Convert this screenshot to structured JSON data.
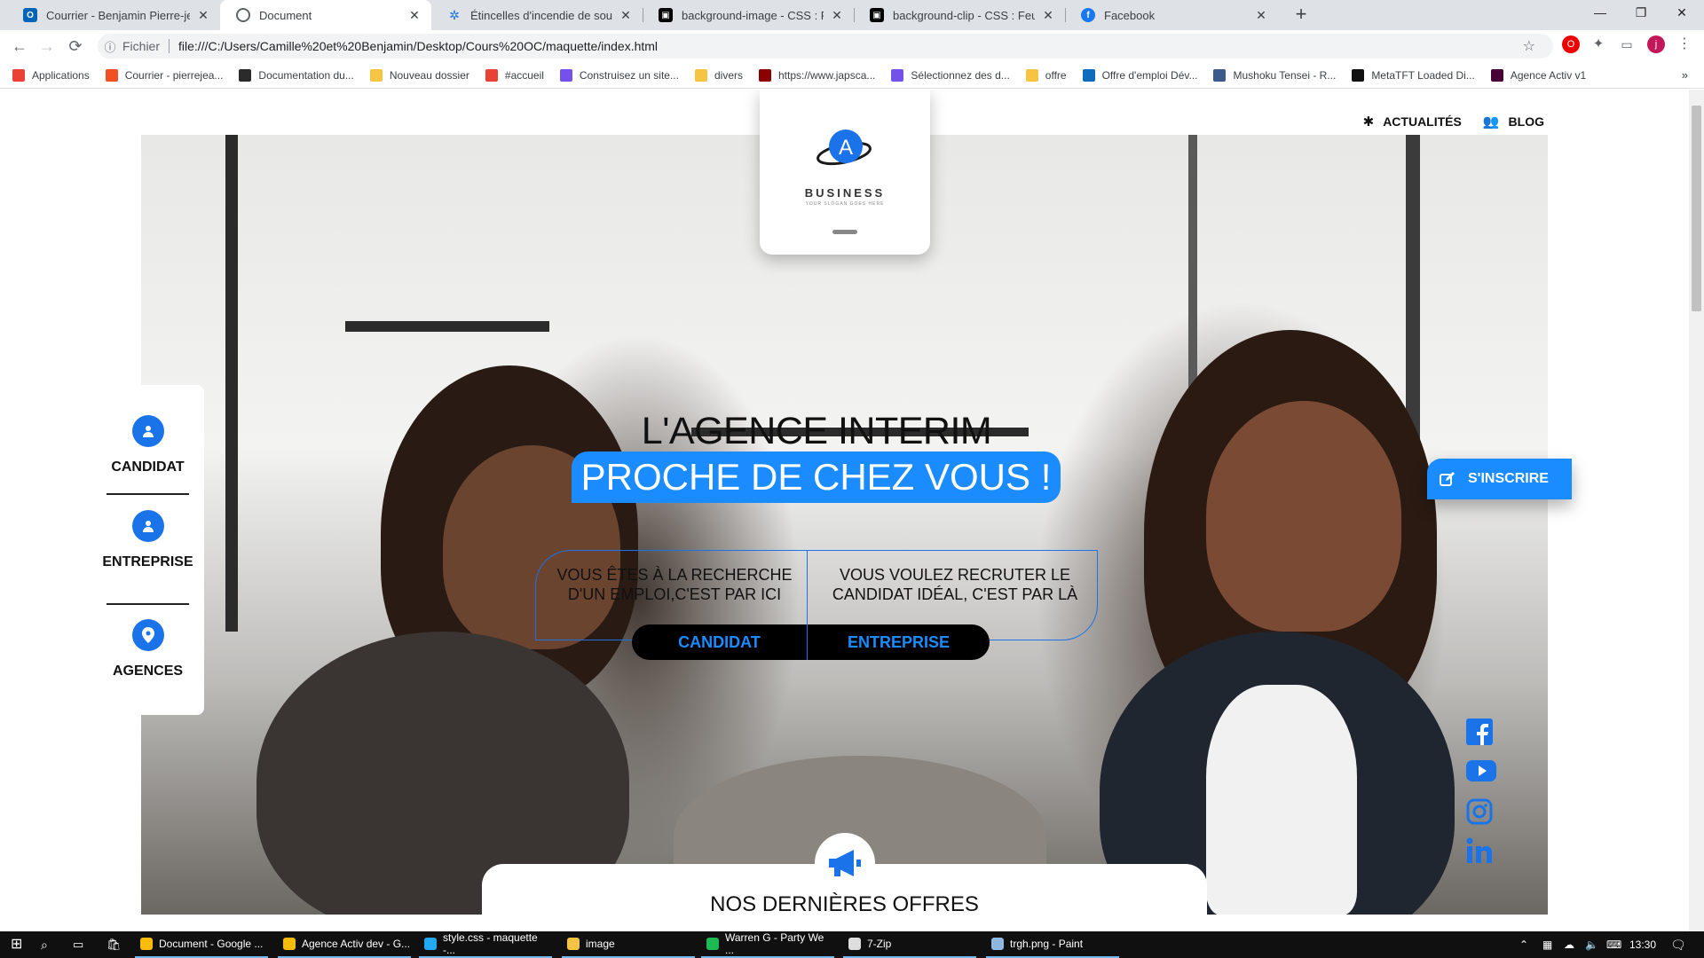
{
  "browser": {
    "tabs": [
      {
        "title": "Courrier - Benjamin Pierre-jean -",
        "favicon": "outlook-icon",
        "color": "#0364b8",
        "active": false
      },
      {
        "title": "Document",
        "favicon": "globe-icon",
        "color": "#5f6368",
        "active": true
      },
      {
        "title": "Étincelles d'incendie de soudage",
        "favicon": "settings-gear-icon",
        "color": "#1a73e8",
        "active": false
      },
      {
        "title": "background-image - CSS : Feuilles",
        "favicon": "mdn-icon",
        "color": "#000000",
        "active": false
      },
      {
        "title": "background-clip - CSS : Feuilles d",
        "favicon": "mdn-icon",
        "color": "#000000",
        "active": false
      },
      {
        "title": "Facebook",
        "favicon": "facebook-icon",
        "color": "#1877f2",
        "active": false
      }
    ],
    "new_tab_symbol": "+",
    "window_controls": {
      "minimize": "—",
      "maximize": "❐",
      "close": "✕"
    },
    "address": {
      "scheme_label": "Fichier",
      "url": "file:///C:/Users/Camille%20et%20Benjamin/Desktop/Cours%20OC/maquette/index.html"
    },
    "profile_initial": "j",
    "bookmarks": [
      {
        "label": "Applications",
        "icon": "apps-grid-icon",
        "color": "#ea4335"
      },
      {
        "label": "Courrier - pierrejea...",
        "icon": "microsoft-icon",
        "color": "#f25022"
      },
      {
        "label": "Documentation du...",
        "icon": "doc-icon",
        "color": "#2b2b2b"
      },
      {
        "label": "Nouveau dossier",
        "icon": "folder-icon",
        "color": "#f6c342"
      },
      {
        "label": "#accueil",
        "icon": "bookmark-icon",
        "color": "#e94235"
      },
      {
        "label": "Construisez un site...",
        "icon": "openclassrooms-icon",
        "color": "#7451eb"
      },
      {
        "label": "divers",
        "icon": "folder-icon",
        "color": "#f6c342"
      },
      {
        "label": "https://www.japsca...",
        "icon": "js-icon",
        "color": "#8b0000"
      },
      {
        "label": "Sélectionnez des d...",
        "icon": "openclassrooms-icon",
        "color": "#7451eb"
      },
      {
        "label": "offre",
        "icon": "folder-icon",
        "color": "#f6c342"
      },
      {
        "label": "Offre d'emploi Dév...",
        "icon": "edge-icon",
        "color": "#0f6cbd"
      },
      {
        "label": "Mushoku Tensei - R...",
        "icon": "camera-icon",
        "color": "#3b5b8c"
      },
      {
        "label": "MetaTFT Loaded Di...",
        "icon": "hex-icon",
        "color": "#111111"
      },
      {
        "label": "Agence Activ v1",
        "icon": "xd-icon",
        "color": "#470137"
      }
    ],
    "bookmarks_more": "»"
  },
  "page": {
    "topnav": [
      {
        "label": "ACTUALITÉS",
        "icon": "gear-icon"
      },
      {
        "label": "BLOG",
        "icon": "users-icon"
      }
    ],
    "logo": {
      "name": "BUSINESS",
      "slogan": "YOUR SLOGAN GOES HERE",
      "letter": "A"
    },
    "sidebar": [
      {
        "label": "CANDIDAT",
        "icon": "user-icon"
      },
      {
        "label": "ENTREPRISE",
        "icon": "user-icon"
      },
      {
        "label": "AGENCES",
        "icon": "map-pin-icon"
      }
    ],
    "hero": {
      "line1": "L'AGENCE INTERIM",
      "line2": "PROCHE DE CHEZ VOUS !"
    },
    "cta": {
      "left_text": "VOUS ÊTES À LA RECHERCHE D'UN EMPLOI,C'EST PAR ICI",
      "right_text": "VOUS VOULEZ RECRUTER LE CANDIDAT IDÉAL, C'EST PAR LÀ",
      "left_button": "CANDIDAT",
      "right_button": "ENTREPRISE"
    },
    "register_button": "S'INSCRIRE",
    "social": [
      "facebook-icon",
      "youtube-icon",
      "instagram-icon",
      "linkedin-icon"
    ],
    "offers": {
      "title": "NOS DERNIÈRES OFFRES",
      "icon": "megaphone-icon"
    },
    "accent_color": "#1a8cff"
  },
  "taskbar": {
    "apps": [
      {
        "label": "Document - Google ...",
        "icon": "chrome-icon",
        "color": "#fbbc05",
        "open": true
      },
      {
        "label": "Agence Activ dev - G...",
        "icon": "chrome-icon",
        "color": "#fbbc05",
        "open": true
      },
      {
        "label": "style.css - maquette -...",
        "icon": "vscode-icon",
        "color": "#23a9f2",
        "open": true
      },
      {
        "label": "image",
        "icon": "folder-icon",
        "color": "#f6c342",
        "open": true
      },
      {
        "label": "Warren G - Party We ...",
        "icon": "spotify-icon",
        "color": "#1db954",
        "open": true
      },
      {
        "label": "7-Zip",
        "icon": "7zip-icon",
        "color": "#dddddd",
        "open": true
      },
      {
        "label": "trgh.png - Paint",
        "icon": "paint-icon",
        "color": "#8fb8e0",
        "open": true
      }
    ],
    "time": "13:30"
  }
}
